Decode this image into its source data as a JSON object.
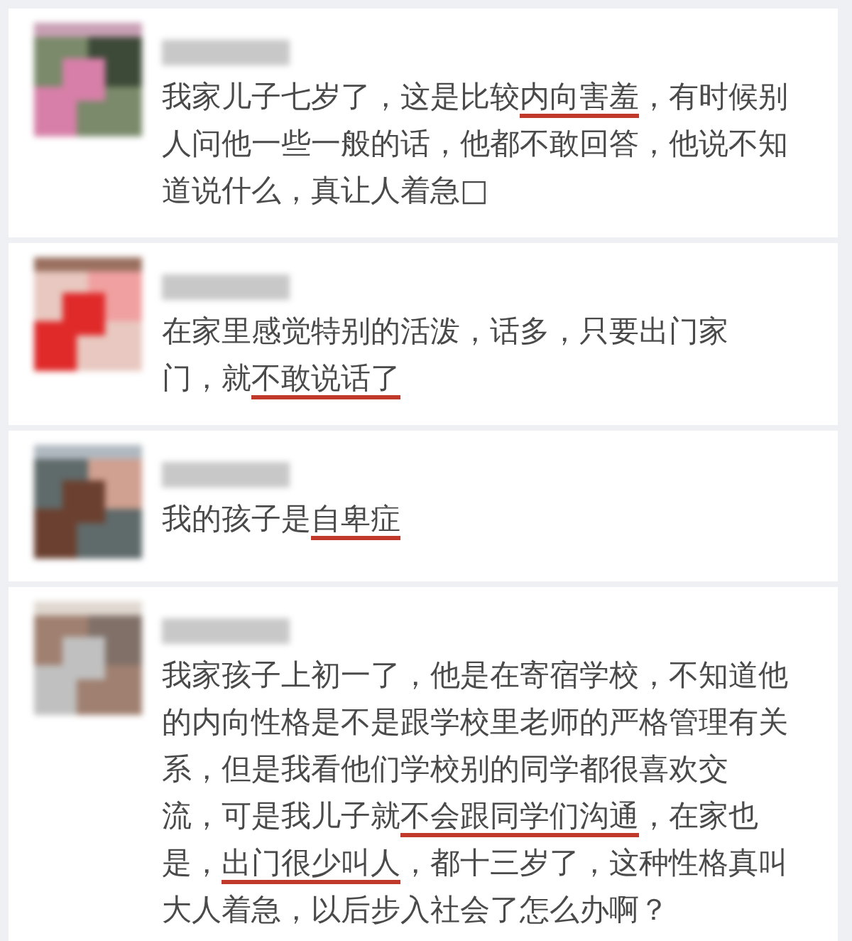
{
  "comments": [
    {
      "avatar": {
        "kind": "picture"
      },
      "lines": [
        [
          {
            "text": "我家儿子七岁了，这是比较",
            "underlined": false
          },
          {
            "text": "内向害羞",
            "underlined": true
          },
          {
            "text": "，有时候别",
            "underlined": false
          }
        ],
        [
          {
            "text": "人问他一些一般的话，他都不敢回答，他说不知",
            "underlined": false
          }
        ],
        [
          {
            "text": "道说什么，真让人着急□",
            "underlined": false
          }
        ]
      ]
    },
    {
      "avatar": {
        "kind": "picture"
      },
      "lines": [
        [
          {
            "text": "在家里感觉特别的活泼，话多，只要出门家",
            "underlined": false
          }
        ],
        [
          {
            "text": "门，就",
            "underlined": false
          },
          {
            "text": "不敢说话了",
            "underlined": true
          }
        ]
      ]
    },
    {
      "avatar": {
        "kind": "picture"
      },
      "lines": [
        [
          {
            "text": "我的孩子是",
            "underlined": false
          },
          {
            "text": "自卑症",
            "underlined": true
          }
        ]
      ]
    },
    {
      "avatar": {
        "kind": "picture"
      },
      "lines": [
        [
          {
            "text": "我家孩子上初一了，他是在寄宿学校，不知道他",
            "underlined": false
          }
        ],
        [
          {
            "text": "的内向性格是不是跟学校里老师的严格管理有关",
            "underlined": false
          }
        ],
        [
          {
            "text": "系，但是我看他们学校别的同学都很喜欢交",
            "underlined": false
          }
        ],
        [
          {
            "text": "流，可是我儿子就",
            "underlined": false
          },
          {
            "text": "不会跟同学们沟通",
            "underlined": true
          },
          {
            "text": "，在家也",
            "underlined": false
          }
        ],
        [
          {
            "text": "是，",
            "underlined": false
          },
          {
            "text": "出门很少叫人",
            "underlined": true
          },
          {
            "text": "，都十三岁了，这种性格真叫",
            "underlined": false
          }
        ],
        [
          {
            "text": "大人着急，以后步入社会了怎么办啊？",
            "underlined": false
          }
        ]
      ]
    }
  ]
}
